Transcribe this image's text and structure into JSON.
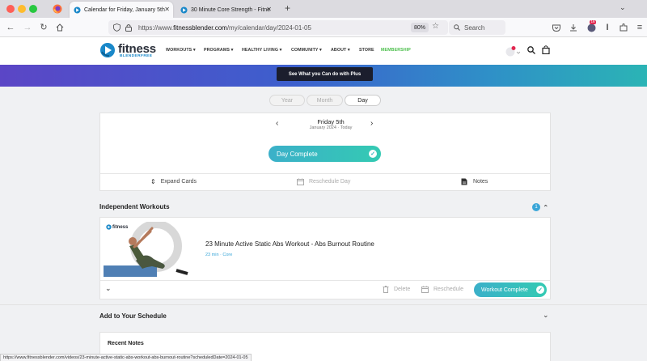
{
  "browser": {
    "tabs": [
      {
        "title": "Calendar for Friday, January 5th",
        "active": true
      },
      {
        "title": "30 Minute Core Strength - Fitne",
        "active": false
      }
    ],
    "url_prefix": "https://www.",
    "url_domain": "fitnessblender.com",
    "url_path": "/my/calendar/day/2024-01-05",
    "zoom": "80%",
    "search_placeholder": "Search",
    "notification_count": "16",
    "status_url": "https://www.fitnessblender.com/videos/23-minute-active-static-abs-workout-abs-burnout-routine?scheduledDate=2024-01-05"
  },
  "site": {
    "logo_word": "fitness",
    "logo_sub": "BLENDERFREE",
    "menu": [
      "WORKOUTS ▾",
      "PROGRAMS ▾",
      "HEALTHY LIVING ▾",
      "COMMUNITY ▾",
      "ABOUT ▾",
      "STORE",
      "MEMBERSHIP"
    ],
    "banner_button": "See What you Can do with Plus",
    "accent": "#3aa6d8",
    "membership_color": "#4cbf4c"
  },
  "calendar": {
    "views": [
      "Year",
      "Month",
      "Day"
    ],
    "selected_view": "Day",
    "date_title": "Friday 5th",
    "date_sub": "January 2024 · Today",
    "day_complete": "Day Complete",
    "actions": {
      "expand": "Expand Cards",
      "reschedule": "Reschedule Day",
      "notes": "Notes"
    }
  },
  "workouts": {
    "section_title": "Independent Workouts",
    "count": "1",
    "items": [
      {
        "title": "23 Minute Active Static Abs Workout - Abs Burnout Routine",
        "meta": "23 min · Core",
        "thumb_logo": "fitness",
        "delete_label": "Delete",
        "reschedule_label": "Reschedule",
        "complete_label": "Workout Complete"
      }
    ]
  },
  "schedule": {
    "title": "Add to Your Schedule"
  },
  "notes": {
    "title": "Recent Notes"
  }
}
